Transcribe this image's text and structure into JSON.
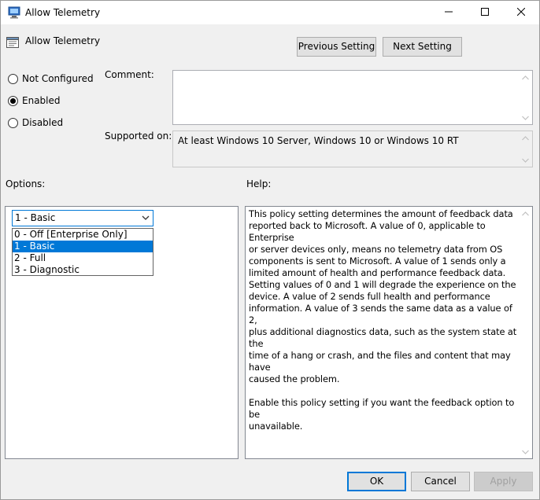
{
  "window": {
    "title": "Allow Telemetry",
    "controls": {
      "minimize_icon": "minimize-icon",
      "maximize_icon": "maximize-icon",
      "close_icon": "close-icon"
    }
  },
  "policy": {
    "name": "Allow Telemetry",
    "icon": "policy-setting-icon"
  },
  "nav": {
    "previous_label": "Previous Setting",
    "next_label": "Next Setting"
  },
  "state": {
    "options": [
      {
        "label": "Not Configured",
        "checked": false
      },
      {
        "label": "Enabled",
        "checked": true
      },
      {
        "label": "Disabled",
        "checked": false
      }
    ]
  },
  "comment": {
    "label": "Comment:",
    "value": ""
  },
  "supported": {
    "label": "Supported on:",
    "value": "At least Windows 10 Server, Windows 10 or Windows 10 RT"
  },
  "options_section": {
    "label": "Options:",
    "combo_value": "1 - Basic",
    "dropdown_items": [
      {
        "label": "0 - Off [Enterprise Only]",
        "selected": false
      },
      {
        "label": "1 - Basic",
        "selected": true
      },
      {
        "label": "2 - Full",
        "selected": false
      },
      {
        "label": "3 - Diagnostic",
        "selected": false
      }
    ]
  },
  "help_section": {
    "label": "Help:",
    "text": "This policy setting determines the amount of feedback data\nreported back to Microsoft. A value of 0, applicable to Enterprise\nor server devices only, means no telemetry data from OS\ncomponents is sent to Microsoft. A value of 1 sends only a\nlimited amount of health and performance feedback data.\nSetting values of 0 and 1 will degrade the experience on the\ndevice. A value of 2 sends full health and performance\ninformation. A value of 3 sends the same data as a value of 2,\nplus additional diagnostics data, such as the system state at the\ntime of a hang or crash, and the files and content that may have\ncaused the problem.\n\nEnable this policy setting if you want the feedback option to be\nunavailable."
  },
  "footer": {
    "ok_label": "OK",
    "cancel_label": "Cancel",
    "apply_label": "Apply"
  },
  "colors": {
    "accent": "#0078d7",
    "dialog_bg": "#f0f0f0",
    "disabled_text": "#a0a0a0"
  }
}
